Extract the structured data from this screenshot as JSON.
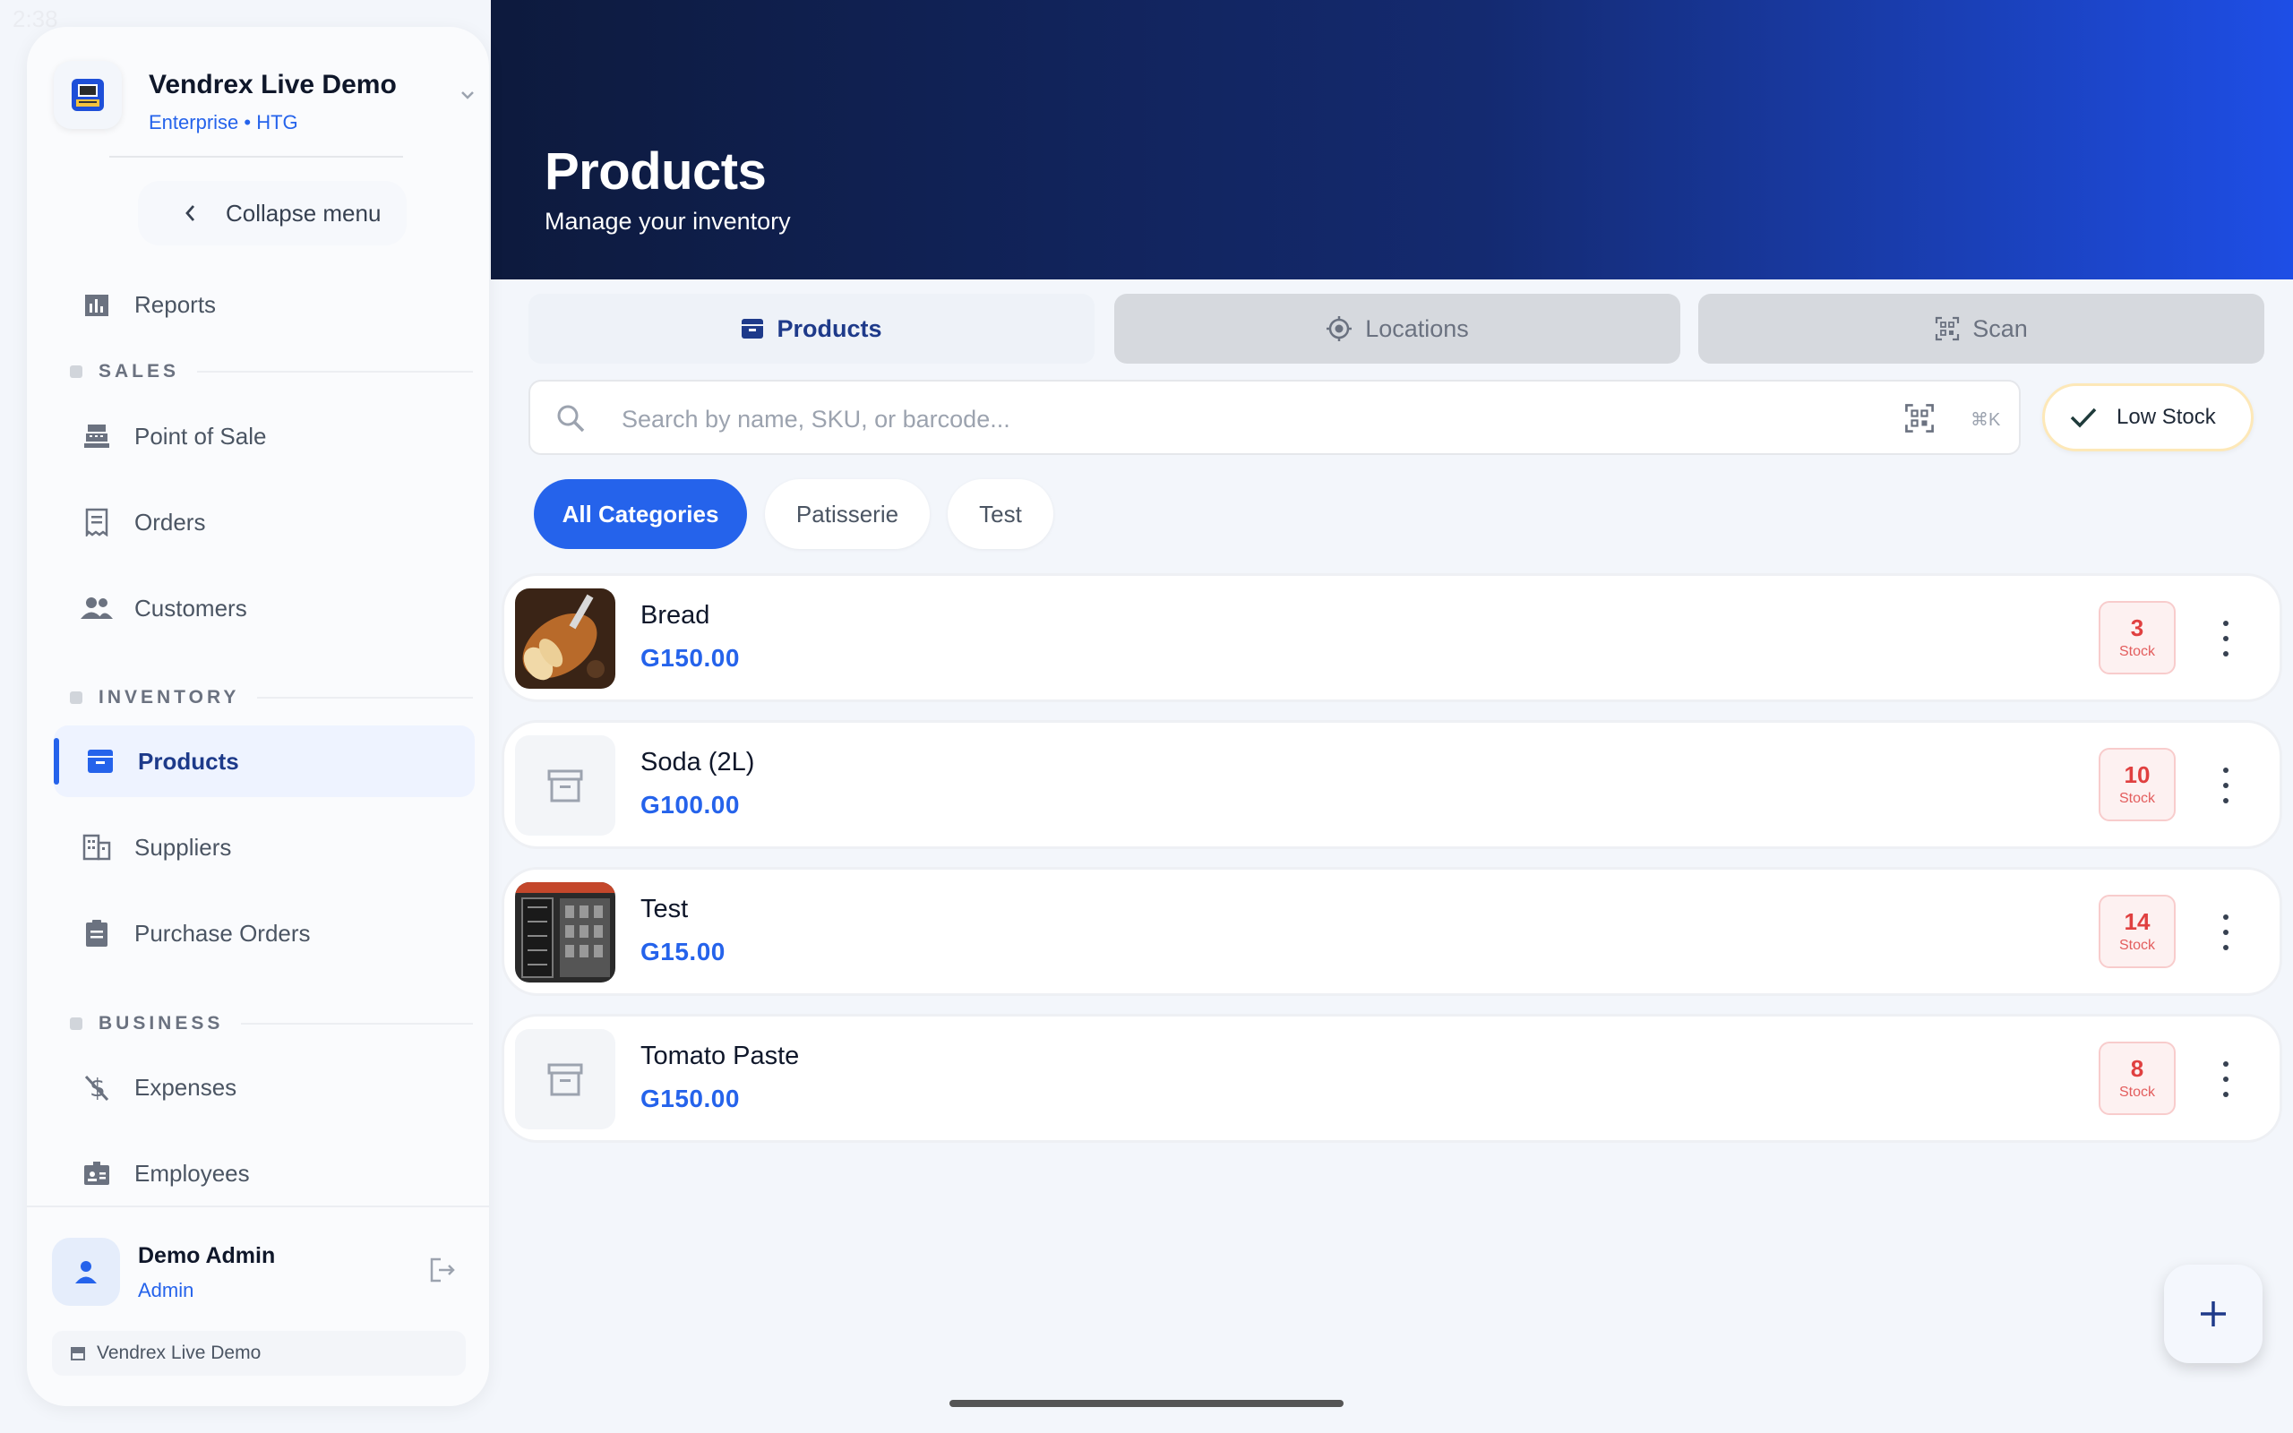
{
  "status": {
    "time": "2:38"
  },
  "header": {
    "title": "Products",
    "subtitle": "Manage your inventory"
  },
  "org": {
    "name": "Vendrex Live Demo",
    "plan": "Enterprise • HTG"
  },
  "sidebar": {
    "collapse_label": "Collapse menu",
    "reports_label": "Reports",
    "sections": {
      "sales": "SALES",
      "inventory": "INVENTORY",
      "business": "BUSINESS"
    },
    "items": {
      "pos": "Point of Sale",
      "orders": "Orders",
      "customers": "Customers",
      "products": "Products",
      "suppliers": "Suppliers",
      "purchase_orders": "Purchase Orders",
      "expenses": "Expenses",
      "employees": "Employees"
    },
    "user": {
      "name": "Demo Admin",
      "role": "Admin"
    },
    "store": "Vendrex Live Demo"
  },
  "tabs": [
    {
      "label": "Products",
      "icon": "archive-icon",
      "active": true
    },
    {
      "label": "Locations",
      "icon": "location-target-icon",
      "active": false
    },
    {
      "label": "Scan",
      "icon": "qr-scan-icon",
      "active": false
    }
  ],
  "search": {
    "placeholder": "Search by name, SKU, or barcode...",
    "value": "",
    "shortcut": "⌘K"
  },
  "filter": {
    "low_stock_label": "Low Stock",
    "checked": true
  },
  "categories": [
    {
      "label": "All Categories",
      "selected": true
    },
    {
      "label": "Patisserie",
      "selected": false
    },
    {
      "label": "Test",
      "selected": false
    }
  ],
  "products": [
    {
      "name": "Bread",
      "price": "G150.00",
      "stock": "3",
      "stock_label": "Stock",
      "image": "bread-photo"
    },
    {
      "name": "Soda (2L)",
      "price": "G100.00",
      "stock": "10",
      "stock_label": "Stock",
      "image": "placeholder-archive-icon"
    },
    {
      "name": "Test",
      "price": "G15.00",
      "stock": "14",
      "stock_label": "Stock",
      "image": "product-photo"
    },
    {
      "name": "Tomato Paste",
      "price": "G150.00",
      "stock": "8",
      "stock_label": "Stock",
      "image": "placeholder-archive-icon"
    }
  ],
  "colors": {
    "accent": "#2563eb",
    "header_dark": "#0d1a3d",
    "stock_red": "#e04040"
  }
}
